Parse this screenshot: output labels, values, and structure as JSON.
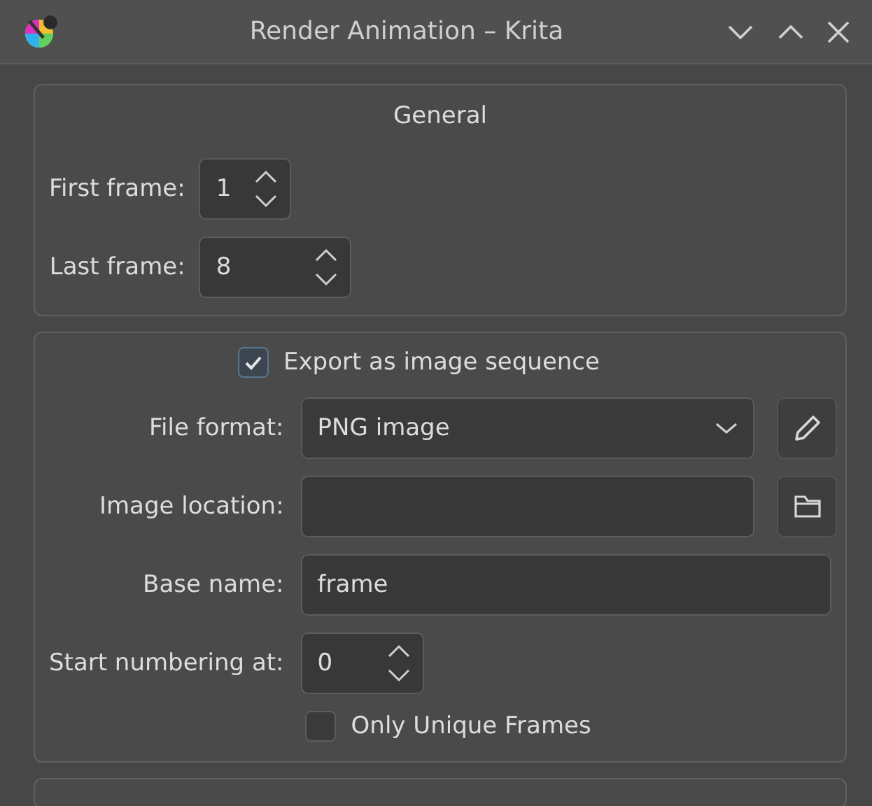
{
  "window": {
    "title": "Render Animation – Krita"
  },
  "general": {
    "title": "General",
    "fields": [
      {
        "label": "First frame:",
        "value": "1"
      },
      {
        "label": "Last frame:",
        "value": "8"
      }
    ]
  },
  "export": {
    "toggle": {
      "label": "Export as image sequence",
      "checked": true
    },
    "rows": [
      {
        "kind": "combo",
        "label": "File format:",
        "value": "PNG image"
      },
      {
        "kind": "file",
        "label": "Image location:"
      },
      {
        "kind": "text",
        "label": "Base name:",
        "value": "frame"
      },
      {
        "kind": "spin",
        "label": "Start numbering at:",
        "value": "0"
      },
      {
        "kind": "checkbox",
        "label": "Only Unique Frames",
        "checked": false
      }
    ]
  }
}
